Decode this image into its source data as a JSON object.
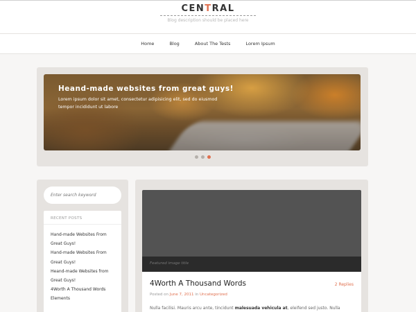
{
  "site": {
    "title_pre": "CEN",
    "title_accent": "T",
    "title_post": "RAL",
    "tagline": "Blog description should be placed here"
  },
  "nav": {
    "items": [
      {
        "label": "Home"
      },
      {
        "label": "Blog"
      },
      {
        "label": "About The Tests"
      },
      {
        "label": "Lorem Ipsum"
      }
    ]
  },
  "slider": {
    "title": "Heand-made websites from great guys!",
    "text": "Lorem ipsum dolor sit amet, consectetur adipisicing elit, sed do eiusmod tempor incididunt ut labore",
    "active_index": 3,
    "dot_count": 3
  },
  "sidebar": {
    "search_placeholder": "Enter search keyword",
    "recent_title": "RECENT POSTS",
    "recent_posts": [
      "Hand-made Websites From",
      "Great Guys!",
      "Hand-made Websites From",
      "Great Guys!",
      "Heand-made Websites from",
      "Great Guys!",
      "4Worth A Thousand Words",
      "Elements"
    ]
  },
  "post": {
    "featured_caption": "Featured image title",
    "title": "4Worth A Thousand Words",
    "replies": "2 Replies",
    "meta_prefix": "Posted on ",
    "meta_date": "June 7, 2011",
    "meta_in": " in ",
    "meta_category": "Uncategorized",
    "excerpt_pre": "Nulla facilisi. Mauris arcu ante, tincidunt ",
    "excerpt_bold": "malesuada vehicula at",
    "excerpt_post": ", eleifend sed justo. Nulla"
  },
  "colors": {
    "accent": "#e0704f",
    "panel": "#e6e3e0",
    "background": "#f7f6f5"
  }
}
